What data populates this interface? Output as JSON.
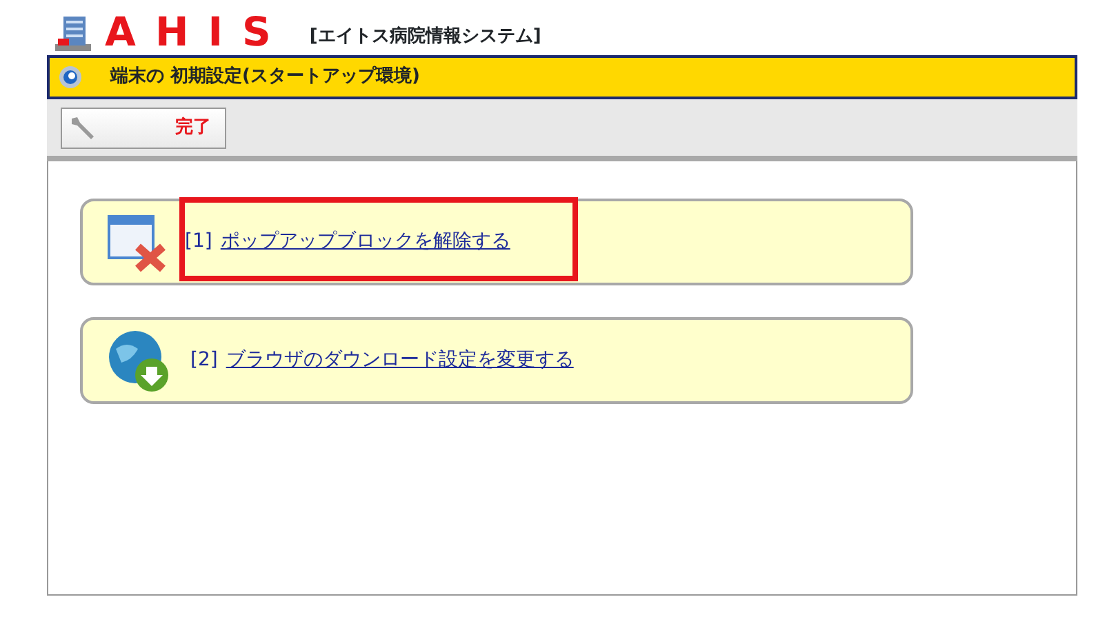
{
  "header": {
    "logo": "AHIS",
    "subtitle": "[エイトス病院情報システム]"
  },
  "title_bar": {
    "title": "端末の 初期設定(スタートアップ環境)"
  },
  "toolbar": {
    "buttons": [
      {
        "label": "完了"
      }
    ]
  },
  "items": [
    {
      "kind": "popup",
      "number": "[1]",
      "link": "ポップアップブロックを解除する",
      "highlighted": true
    },
    {
      "kind": "download",
      "number": "[2]",
      "link": "ブラウザのダウンロード設定を変更する",
      "highlighted": false
    }
  ]
}
